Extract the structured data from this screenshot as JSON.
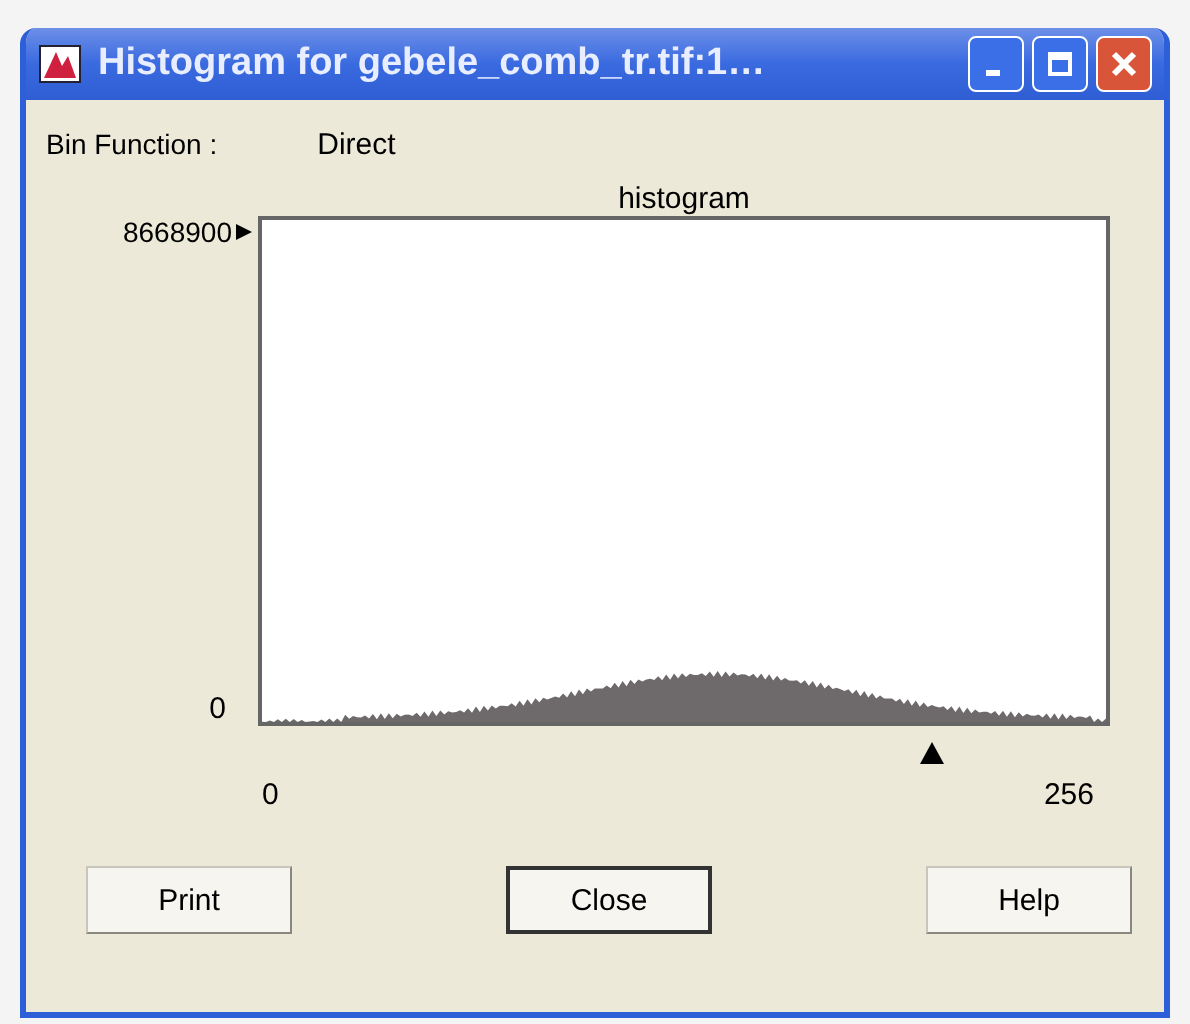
{
  "window": {
    "title": "Histogram for gebele_comb_tr.tif:1…"
  },
  "bin_function": {
    "label": "Bin Function :",
    "value": "Direct"
  },
  "chart": {
    "title": "histogram",
    "y_max_label": "8668900",
    "y_min_label": "0",
    "x_min_label": "0",
    "x_max_label": "256"
  },
  "threshold": {
    "level": 0.79
  },
  "buttons": [
    {
      "label": "Print",
      "default": false
    },
    {
      "label": "Close",
      "default": true
    },
    {
      "label": "Help",
      "default": false
    }
  ]
}
